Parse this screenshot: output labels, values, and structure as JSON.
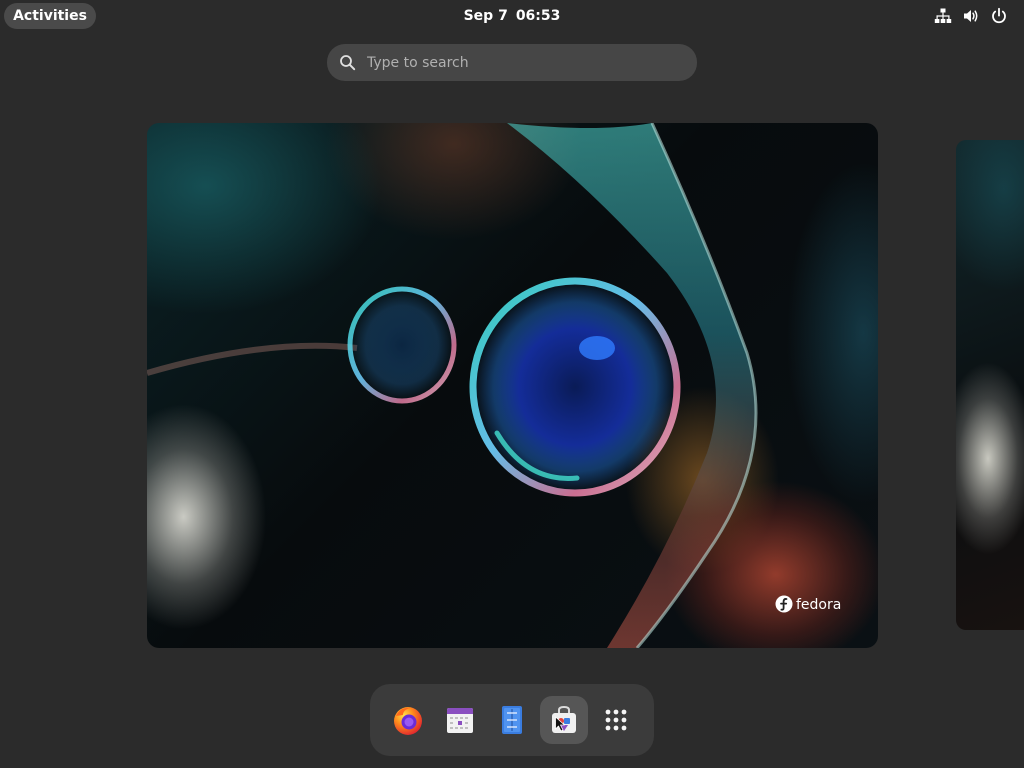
{
  "top_bar": {
    "activities_label": "Activities",
    "date": "Sep 7",
    "time": "06:53",
    "tray_icons": [
      "network-wired-icon",
      "volume-icon",
      "power-icon"
    ]
  },
  "search": {
    "placeholder": "Type to search",
    "value": ""
  },
  "workspace": {
    "wallpaper_logo_text": "fedora"
  },
  "dock": {
    "items": [
      {
        "name": "firefox-icon",
        "active": false
      },
      {
        "name": "calendar-icon",
        "active": false
      },
      {
        "name": "text-editor-icon",
        "active": false
      },
      {
        "name": "software-icon",
        "active": true
      },
      {
        "name": "show-apps-icon",
        "active": false
      }
    ]
  },
  "colors": {
    "panel_background": "#2b2b2b",
    "pill": "#4a4a4a",
    "search_field": "#464646",
    "dock": "#3b3b3b",
    "dock_active": "#565656"
  }
}
